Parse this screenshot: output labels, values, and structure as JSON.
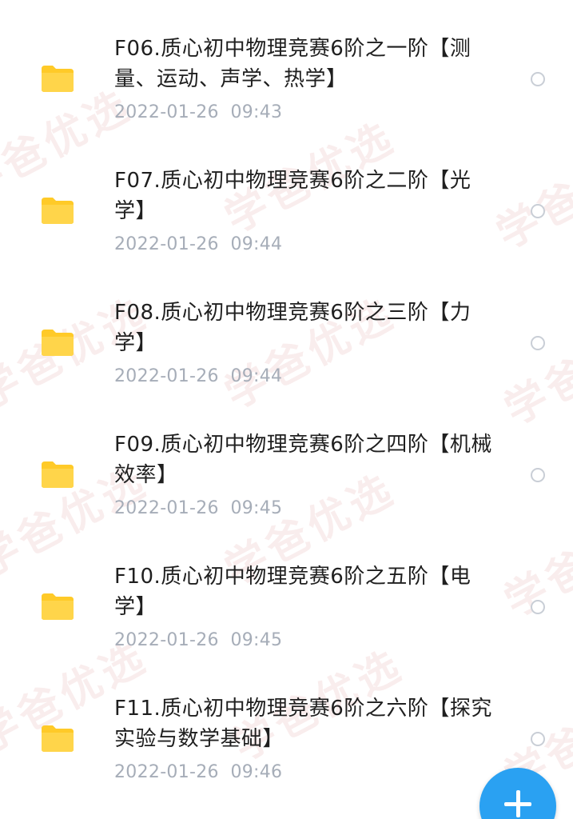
{
  "files": [
    {
      "name": "F06.质心初中物理竞赛6阶之一阶【测量、运动、声学、热学】",
      "date": "2022-01-26  09:43"
    },
    {
      "name": "F07.质心初中物理竞赛6阶之二阶【光学】",
      "date": "2022-01-26  09:44"
    },
    {
      "name": "F08.质心初中物理竞赛6阶之三阶【力学】",
      "date": "2022-01-26  09:44"
    },
    {
      "name": "F09.质心初中物理竞赛6阶之四阶【机械效率】",
      "date": "2022-01-26  09:45"
    },
    {
      "name": "F10.质心初中物理竞赛6阶之五阶【电学】",
      "date": "2022-01-26  09:45"
    },
    {
      "name": "F11.质心初中物理竞赛6阶之六阶【探究实验与数学基础】",
      "date": "2022-01-26  09:46"
    }
  ],
  "icons": {
    "folder": "folder-icon",
    "select": "select-radio-icon",
    "fab": "plus-icon"
  },
  "colors": {
    "folder": "#ffd54a",
    "folder_tab": "#ffca28",
    "fab": "#2aa1f2",
    "date": "#a6adb8"
  },
  "watermark": "学爸优选"
}
